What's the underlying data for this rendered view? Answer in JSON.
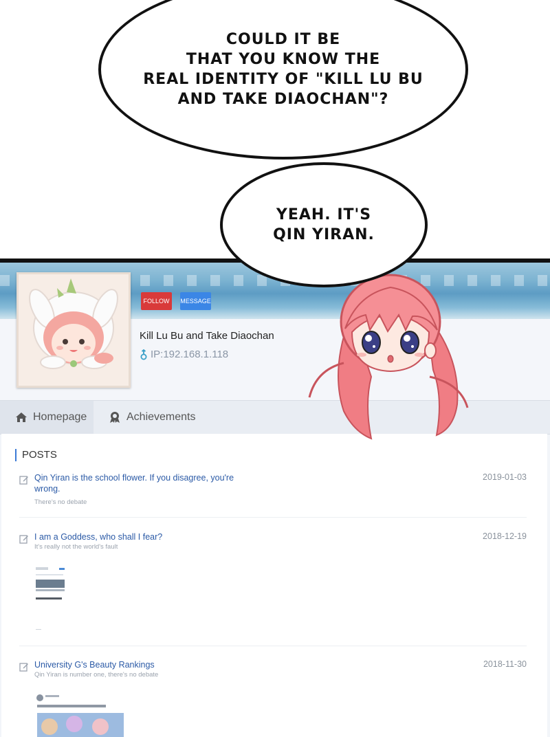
{
  "bubbles": {
    "first": "COULD IT BE\nTHAT YOU KNOW THE\nREAL IDENTITY OF \"KILL LU BU\nAND TAKE DIAOCHAN\"?",
    "second": "YEAH. IT'S\nQIN YIRAN."
  },
  "profile": {
    "follow_label": "FOLLOW",
    "message_label": "MESSAGE",
    "username": "Kill Lu Bu and Take Diaochan",
    "ip": "IP:192.168.1.118"
  },
  "tabs": [
    {
      "label": "Homepage",
      "icon": "home-icon"
    },
    {
      "label": "Achievements",
      "icon": "medal-icon"
    }
  ],
  "posts_title": "POSTS",
  "posts": [
    {
      "title": "Qin Yiran is the school flower. If you disagree, you're wrong.",
      "subtitle": "There's no debate",
      "date": "2019-01-03"
    },
    {
      "title": "I am a Goddess, who shall I fear?",
      "subtitle": "It's really not the world's fault",
      "date": "2018-12-19"
    },
    {
      "title": "University G's Beauty Rankings",
      "subtitle": "Qin Yiran is number one, there's no debate",
      "date": "2018-11-30"
    }
  ],
  "colors": {
    "follow": "#d93a3a",
    "message": "#3b86e6",
    "link": "#2b5aa6",
    "hair": "#f07d84"
  }
}
